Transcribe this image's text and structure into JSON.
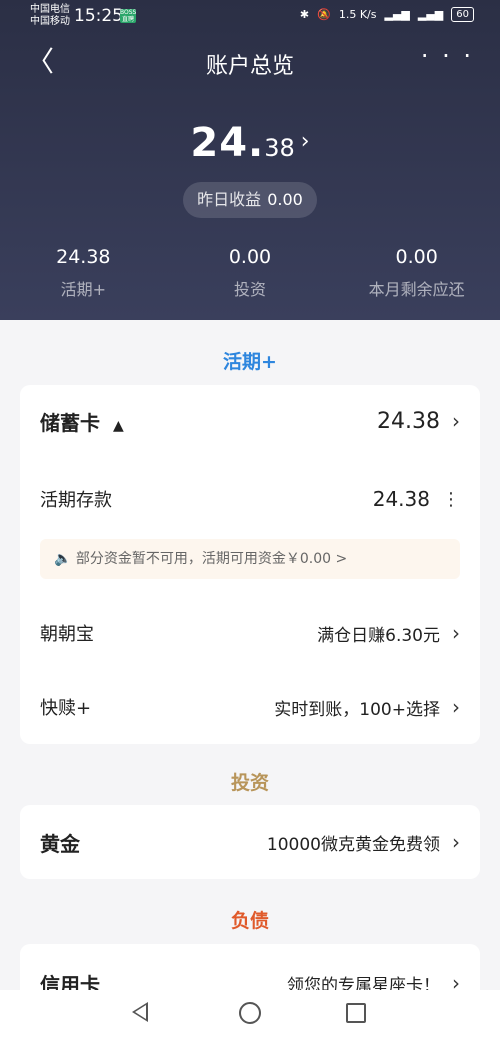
{
  "status_bar": {
    "carrier1": "中国电信",
    "carrier2": "中国移动",
    "time": "15:25",
    "badge": "BOSS 直聘",
    "network": "1.5 K/s",
    "battery": "60"
  },
  "nav": {
    "back_icon": "chevron-left-icon",
    "title": "账户总览",
    "more": "· · ·"
  },
  "total": {
    "integer": "24.",
    "decimal": "38",
    "arrow": "›"
  },
  "yesterday": {
    "label": "昨日收益",
    "value": "0.00"
  },
  "summary": [
    {
      "value": "24.38",
      "label": "活期+"
    },
    {
      "value": "0.00",
      "label": "投资"
    },
    {
      "value": "0.00",
      "label": "本月剩余应还"
    }
  ],
  "sections": {
    "current": {
      "title": "活期+",
      "color": "#2e86de"
    },
    "invest": {
      "title": "投资",
      "color": "#b8955a"
    },
    "debt": {
      "title": "负债",
      "color": "#e05a2b"
    }
  },
  "card_current": {
    "savings_title": "储蓄卡",
    "savings_value": "24.38",
    "deposit_label": "活期存款",
    "deposit_value": "24.38",
    "notice": "部分资金暂不可用，活期可用资金￥0.00 >",
    "zhaozhao_label": "朝朝宝",
    "zhaozhao_value": "满仓日赚6.30元",
    "kuaishu_label": "快赎+",
    "kuaishu_value": "实时到账，100+选择"
  },
  "card_invest": {
    "gold_label": "黄金",
    "gold_value": "10000微克黄金免费领"
  },
  "card_debt": {
    "credit_label": "信用卡",
    "credit_value": "领您的专属星座卡！"
  }
}
